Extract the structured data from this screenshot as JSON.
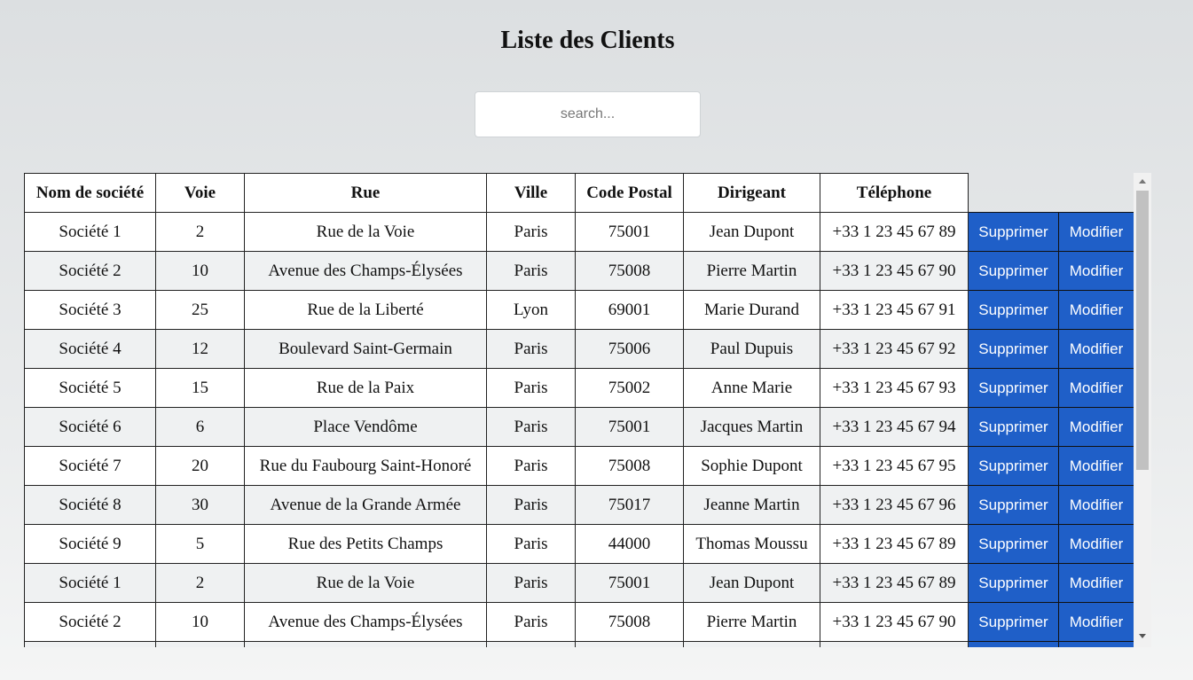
{
  "page": {
    "title": "Liste des Clients"
  },
  "search": {
    "placeholder": "search...",
    "value": ""
  },
  "table": {
    "headers": {
      "company": "Nom de société",
      "street_number": "Voie",
      "street": "Rue",
      "city": "Ville",
      "postal_code": "Code Postal",
      "manager": "Dirigeant",
      "phone": "Téléphone"
    },
    "delete_label": "Supprimer",
    "edit_label": "Modifier",
    "rows": [
      {
        "company": "Société 1",
        "street_number": "2",
        "street": "Rue de la Voie",
        "city": "Paris",
        "postal_code": "75001",
        "manager": "Jean Dupont",
        "phone": "+33 1 23 45 67 89"
      },
      {
        "company": "Société 2",
        "street_number": "10",
        "street": "Avenue des Champs-Élysées",
        "city": "Paris",
        "postal_code": "75008",
        "manager": "Pierre Martin",
        "phone": "+33 1 23 45 67 90"
      },
      {
        "company": "Société 3",
        "street_number": "25",
        "street": "Rue de la Liberté",
        "city": "Lyon",
        "postal_code": "69001",
        "manager": "Marie Durand",
        "phone": "+33 1 23 45 67 91"
      },
      {
        "company": "Société 4",
        "street_number": "12",
        "street": "Boulevard Saint-Germain",
        "city": "Paris",
        "postal_code": "75006",
        "manager": "Paul Dupuis",
        "phone": "+33 1 23 45 67 92"
      },
      {
        "company": "Société 5",
        "street_number": "15",
        "street": "Rue de la Paix",
        "city": "Paris",
        "postal_code": "75002",
        "manager": "Anne Marie",
        "phone": "+33 1 23 45 67 93"
      },
      {
        "company": "Société 6",
        "street_number": "6",
        "street": "Place Vendôme",
        "city": "Paris",
        "postal_code": "75001",
        "manager": "Jacques Martin",
        "phone": "+33 1 23 45 67 94"
      },
      {
        "company": "Société 7",
        "street_number": "20",
        "street": "Rue du Faubourg Saint-Honoré",
        "city": "Paris",
        "postal_code": "75008",
        "manager": "Sophie Dupont",
        "phone": "+33 1 23 45 67 95"
      },
      {
        "company": "Société 8",
        "street_number": "30",
        "street": "Avenue de la Grande Armée",
        "city": "Paris",
        "postal_code": "75017",
        "manager": "Jeanne Martin",
        "phone": "+33 1 23 45 67 96"
      },
      {
        "company": "Société 9",
        "street_number": "5",
        "street": "Rue des Petits Champs",
        "city": "Paris",
        "postal_code": "44000",
        "manager": "Thomas Moussu",
        "phone": "+33 1 23 45 67 89"
      },
      {
        "company": "Société 1",
        "street_number": "2",
        "street": "Rue de la Voie",
        "city": "Paris",
        "postal_code": "75001",
        "manager": "Jean Dupont",
        "phone": "+33 1 23 45 67 89"
      },
      {
        "company": "Société 2",
        "street_number": "10",
        "street": "Avenue des Champs-Élysées",
        "city": "Paris",
        "postal_code": "75008",
        "manager": "Pierre Martin",
        "phone": "+33 1 23 45 67 90"
      },
      {
        "company": "",
        "street_number": "",
        "street": "",
        "city": "",
        "postal_code": "",
        "manager": "",
        "phone": ""
      }
    ]
  },
  "colors": {
    "action_button": "#1f5fc8",
    "row_alt": "#eff1f2"
  },
  "icons": {
    "scroll_up": "arrow-up-icon",
    "scroll_down": "arrow-down-icon"
  }
}
